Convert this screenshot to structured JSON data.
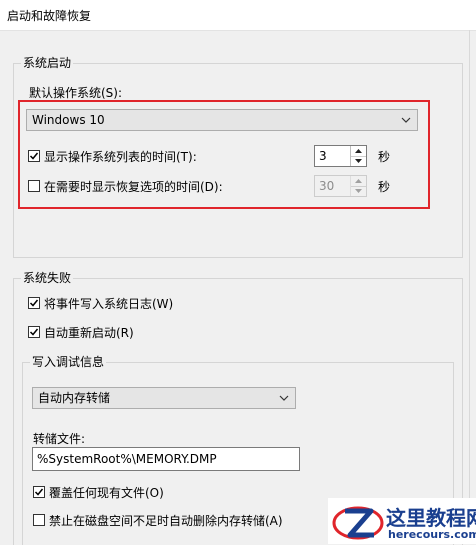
{
  "window": {
    "title": "启动和故障恢复"
  },
  "system_startup": {
    "group_label": "系统启动",
    "default_os_label": "默认操作系统(S):",
    "default_os_value": "Windows 10",
    "show_list": {
      "label": "显示操作系统列表的时间(T):",
      "checked": true,
      "value": "3",
      "unit": "秒"
    },
    "show_recovery": {
      "label": "在需要时显示恢复选项的时间(D):",
      "checked": false,
      "value": "30",
      "unit": "秒"
    }
  },
  "system_failure": {
    "group_label": "系统失败",
    "write_event": {
      "label": "将事件写入系统日志(W)",
      "checked": true
    },
    "auto_restart": {
      "label": "自动重新启动(R)",
      "checked": true
    },
    "debug_info": {
      "group_label": "写入调试信息",
      "dump_type": "自动内存转储",
      "dump_file_label": "转储文件:",
      "dump_file_value": "%SystemRoot%\\MEMORY.DMP",
      "overwrite": {
        "label": "覆盖任何现有文件(O)",
        "checked": true
      },
      "disable_auto_delete": {
        "label": "禁止在磁盘空间不足时自动删除内存转储(A)",
        "checked": false
      }
    }
  },
  "watermark": {
    "title": "这里教程网",
    "url": "herecours.com"
  },
  "colors": {
    "highlight_box": "#e0252b",
    "watermark_blue": "#1a3f8f"
  }
}
